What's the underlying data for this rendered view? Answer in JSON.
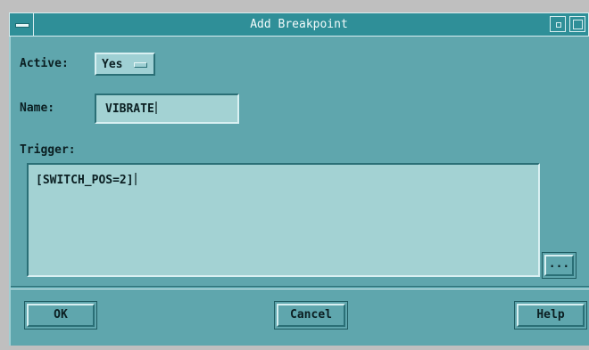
{
  "window": {
    "title": "Add Breakpoint"
  },
  "form": {
    "active_label": "Active:",
    "active_value": "Yes",
    "name_label": "Name:",
    "name_value": "VIBRATE",
    "trigger_label": "Trigger:",
    "trigger_value": "[SWITCH_POS=2]",
    "ellipsis_label": "..."
  },
  "buttons": {
    "ok": "OK",
    "cancel": "Cancel",
    "help": "Help"
  },
  "colors": {
    "dialog_bg": "#5fa6ad",
    "titlebar_bg": "#2f8f98",
    "field_bg": "#a3d2d3"
  }
}
